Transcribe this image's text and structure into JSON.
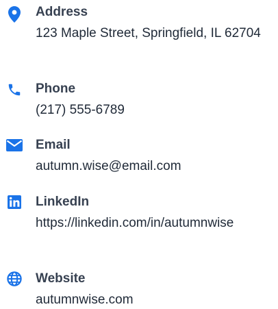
{
  "accent_color": "#1a73e8",
  "contacts": {
    "address": {
      "icon": "map-pin-icon",
      "label": "Address",
      "value": "123 Maple Street, Springfield, IL 62704"
    },
    "phone": {
      "icon": "phone-icon",
      "label": "Phone",
      "value": "(217) 555-6789"
    },
    "email": {
      "icon": "envelope-icon",
      "label": "Email",
      "value": "autumn.wise@email.com"
    },
    "linkedin": {
      "icon": "linkedin-icon",
      "label": "LinkedIn",
      "value": "https://linkedin.com/in/autumnwise"
    },
    "website": {
      "icon": "globe-icon",
      "label": "Website",
      "value": "autumnwise.com"
    }
  }
}
